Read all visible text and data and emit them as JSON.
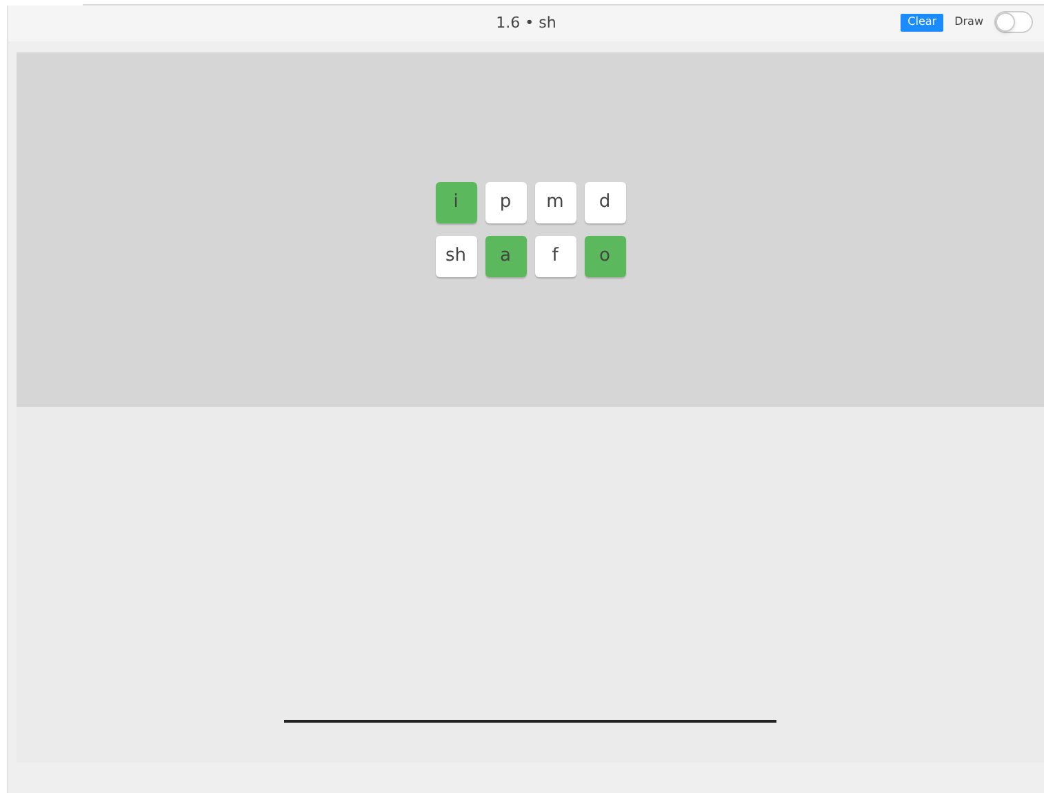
{
  "header": {
    "title": "1.6 • sh",
    "clear_button": "Clear",
    "draw_toggle": {
      "label": "Draw",
      "on": false
    }
  },
  "tiles": [
    {
      "label": "i",
      "selected": true
    },
    {
      "label": "p",
      "selected": false
    },
    {
      "label": "m",
      "selected": false
    },
    {
      "label": "d",
      "selected": false
    },
    {
      "label": "sh",
      "selected": false
    },
    {
      "label": "a",
      "selected": true
    },
    {
      "label": "f",
      "selected": false
    },
    {
      "label": "o",
      "selected": true
    }
  ]
}
